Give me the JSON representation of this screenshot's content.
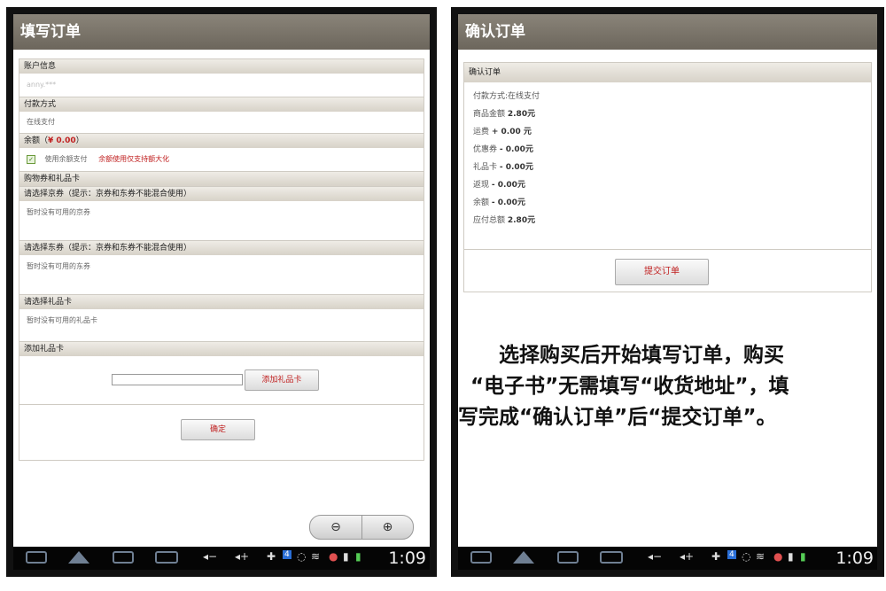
{
  "left": {
    "title": "填写订单",
    "account_header": "账户信息",
    "account_value": "anny.***",
    "payment_header": "付款方式",
    "payment_value": "在线支付",
    "balance_header_prefix": "余额（",
    "balance_amount": "¥ 0.00",
    "balance_header_suffix": "）",
    "use_balance_label": "使用余额支付",
    "balance_note": "余额使用仅支持额大化",
    "coupons_header": "购物券和礼品卡",
    "jing_header": "请选择京券（提示：京券和东券不能混合使用）",
    "jing_empty": "暂时没有可用的京券",
    "dong_header": "请选择东券（提示：京券和东券不能混合使用）",
    "dong_empty": "暂时没有可用的东券",
    "gift_header": "请选择礼品卡",
    "gift_empty": "暂时没有可用的礼品卡",
    "add_gift_header": "添加礼品卡",
    "add_gift_button": "添加礼品卡",
    "confirm_button": "确定"
  },
  "right": {
    "title": "确认订单",
    "section_header": "确认订单",
    "lines": [
      {
        "label": "付款方式:",
        "value": "在线支付"
      },
      {
        "label": "商品金额 ",
        "value": "2.80元"
      },
      {
        "label": "运费 ",
        "value": "+ 0.00 元"
      },
      {
        "label": "优惠券 ",
        "value": "- 0.00元"
      },
      {
        "label": "礼品卡 ",
        "value": "- 0.00元"
      },
      {
        "label": "返现 ",
        "value": "- 0.00元"
      },
      {
        "label": "余额 ",
        "value": "- 0.00元"
      },
      {
        "label": "应付总额 ",
        "value": "2.80元"
      }
    ],
    "submit_button": "提交订单"
  },
  "caption": [
    "　　选择购买后开始填写订单，购买",
    "“电子书”无需填写“收货地址”，填",
    "写完成“确认订单”后“提交订单”。"
  ],
  "statusbar": {
    "clock": "1:09",
    "badge": "4"
  },
  "colors": {
    "titlebar": "#7a7469",
    "accent_red": "#c02020",
    "section_bg": "#e2ddd4"
  }
}
